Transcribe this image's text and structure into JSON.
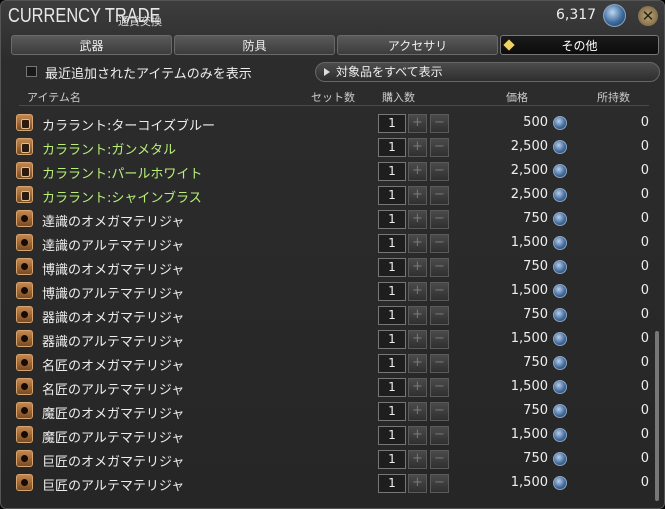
{
  "window": {
    "title": "CURRENCY TRADE",
    "subtitle": "通貨交換",
    "currency_amount": "6,317",
    "close_icon": "close-icon",
    "currency_icon": "currency-coin-icon"
  },
  "tabs": [
    {
      "label": "武器",
      "active": false
    },
    {
      "label": "防具",
      "active": false
    },
    {
      "label": "アクセサリ",
      "active": false
    },
    {
      "label": "その他",
      "active": true
    }
  ],
  "filter": {
    "checkbox_label": "最近追加されたアイテムのみを表示",
    "checked": false,
    "show_all_label": "対象品をすべて表示"
  },
  "columns": {
    "item_name": "アイテム名",
    "set_count": "セット数",
    "purchase_count": "購入数",
    "price": "価格",
    "owned": "所持数"
  },
  "items": [
    {
      "name": "カララント:ターコイズブルー",
      "type": "dye",
      "green": false,
      "qty": "1",
      "price": "500",
      "owned": "0"
    },
    {
      "name": "カララント:ガンメタル",
      "type": "dye",
      "green": true,
      "qty": "1",
      "price": "2,500",
      "owned": "0"
    },
    {
      "name": "カララント:パールホワイト",
      "type": "dye",
      "green": true,
      "qty": "1",
      "price": "2,500",
      "owned": "0"
    },
    {
      "name": "カララント:シャインブラス",
      "type": "dye",
      "green": true,
      "qty": "1",
      "price": "2,500",
      "owned": "0"
    },
    {
      "name": "達識のオメガマテリジャ",
      "type": "materia",
      "green": false,
      "qty": "1",
      "price": "750",
      "owned": "0"
    },
    {
      "name": "達識のアルテマテリジャ",
      "type": "materia",
      "green": false,
      "qty": "1",
      "price": "1,500",
      "owned": "0"
    },
    {
      "name": "博識のオメガマテリジャ",
      "type": "materia",
      "green": false,
      "qty": "1",
      "price": "750",
      "owned": "0"
    },
    {
      "name": "博識のアルテマテリジャ",
      "type": "materia",
      "green": false,
      "qty": "1",
      "price": "1,500",
      "owned": "0"
    },
    {
      "name": "器識のオメガマテリジャ",
      "type": "materia",
      "green": false,
      "qty": "1",
      "price": "750",
      "owned": "0"
    },
    {
      "name": "器識のアルテマテリジャ",
      "type": "materia",
      "green": false,
      "qty": "1",
      "price": "1,500",
      "owned": "0"
    },
    {
      "name": "名匠のオメガマテリジャ",
      "type": "materia",
      "green": false,
      "qty": "1",
      "price": "750",
      "owned": "0"
    },
    {
      "name": "名匠のアルテマテリジャ",
      "type": "materia",
      "green": false,
      "qty": "1",
      "price": "1,500",
      "owned": "0"
    },
    {
      "name": "魔匠のオメガマテリジャ",
      "type": "materia",
      "green": false,
      "qty": "1",
      "price": "750",
      "owned": "0"
    },
    {
      "name": "魔匠のアルテマテリジャ",
      "type": "materia",
      "green": false,
      "qty": "1",
      "price": "1,500",
      "owned": "0"
    },
    {
      "name": "巨匠のオメガマテリジャ",
      "type": "materia",
      "green": false,
      "qty": "1",
      "price": "750",
      "owned": "0"
    },
    {
      "name": "巨匠のアルテマテリジャ",
      "type": "materia",
      "green": false,
      "qty": "1",
      "price": "1,500",
      "owned": "0"
    }
  ],
  "buttons": {
    "plus": "+",
    "minus": "−",
    "close": "✕"
  },
  "colors": {
    "highlight_green": "#b8f07a",
    "active_tab_marker": "#f0d060"
  }
}
